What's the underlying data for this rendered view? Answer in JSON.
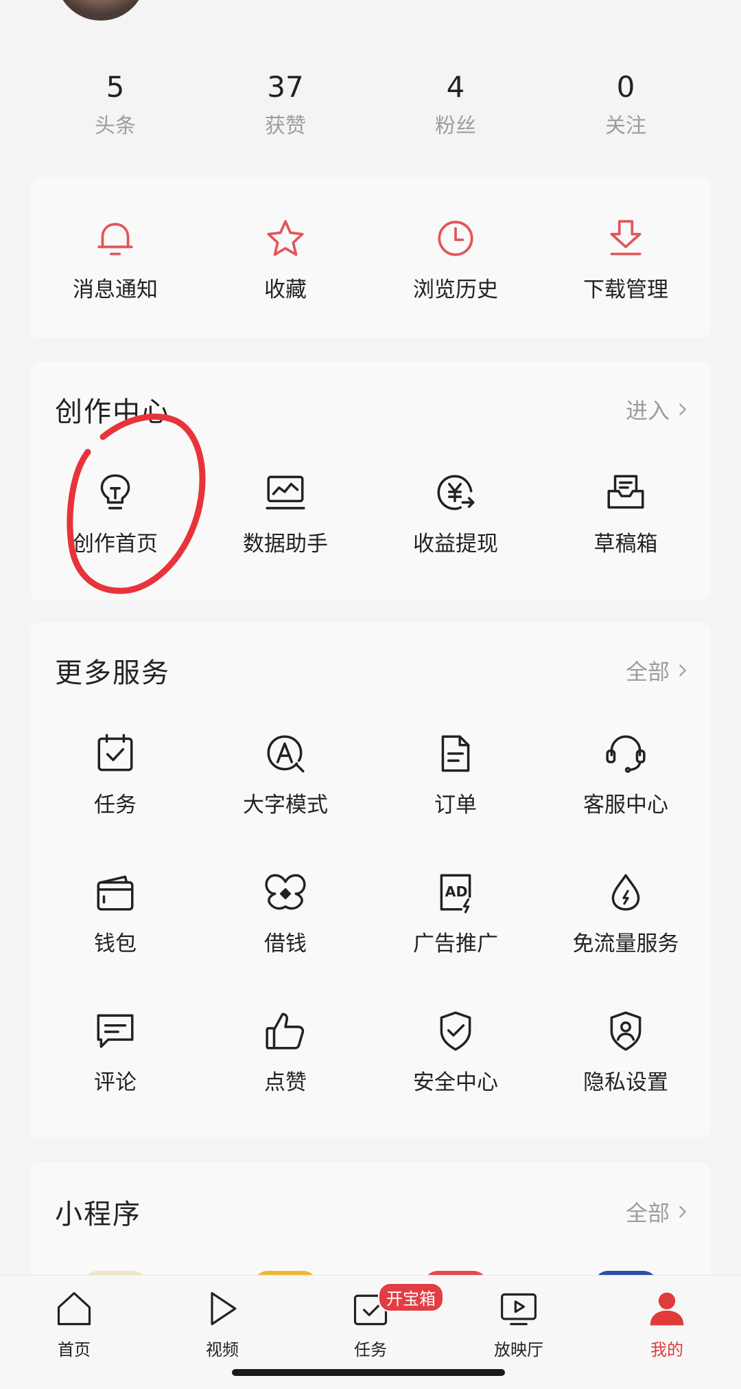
{
  "stats": [
    {
      "value": "5",
      "label": "头条"
    },
    {
      "value": "37",
      "label": "获赞"
    },
    {
      "value": "4",
      "label": "粉丝"
    },
    {
      "value": "0",
      "label": "关注"
    }
  ],
  "quick_actions": [
    {
      "label": "消息通知",
      "icon": "bell-icon"
    },
    {
      "label": "收藏",
      "icon": "star-icon"
    },
    {
      "label": "浏览历史",
      "icon": "clock-icon"
    },
    {
      "label": "下载管理",
      "icon": "download-icon"
    }
  ],
  "creator_center": {
    "title": "创作中心",
    "link": "进入",
    "items": [
      {
        "label": "创作首页",
        "icon": "lightbulb-icon"
      },
      {
        "label": "数据助手",
        "icon": "chart-monitor-icon"
      },
      {
        "label": "收益提现",
        "icon": "yuan-withdraw-icon"
      },
      {
        "label": "草稿箱",
        "icon": "draft-box-icon"
      }
    ]
  },
  "more_services": {
    "title": "更多服务",
    "link": "全部",
    "items": [
      {
        "label": "任务",
        "icon": "task-calendar-icon"
      },
      {
        "label": "大字模式",
        "icon": "large-font-icon"
      },
      {
        "label": "订单",
        "icon": "order-document-icon"
      },
      {
        "label": "客服中心",
        "icon": "headset-icon"
      },
      {
        "label": "钱包",
        "icon": "wallet-icon"
      },
      {
        "label": "借钱",
        "icon": "loan-icon"
      },
      {
        "label": "广告推广",
        "icon": "ad-icon"
      },
      {
        "label": "免流量服务",
        "icon": "data-drop-icon"
      },
      {
        "label": "评论",
        "icon": "comment-icon"
      },
      {
        "label": "点赞",
        "icon": "thumbs-up-icon"
      },
      {
        "label": "安全中心",
        "icon": "shield-check-icon"
      },
      {
        "label": "隐私设置",
        "icon": "privacy-shield-icon"
      }
    ]
  },
  "mini_programs": {
    "title": "小程序",
    "link": "全部"
  },
  "bottom_nav": [
    {
      "label": "首页",
      "icon": "home-icon"
    },
    {
      "label": "视频",
      "icon": "play-icon"
    },
    {
      "label": "任务",
      "icon": "task-check-icon",
      "badge": "开宝箱"
    },
    {
      "label": "放映厅",
      "icon": "tv-play-icon"
    },
    {
      "label": "我的",
      "icon": "user-icon",
      "active": true
    }
  ],
  "colors": {
    "accent": "#e03a3a",
    "quick_icon": "#e2555a",
    "secondary_text": "#9d9d9d"
  }
}
